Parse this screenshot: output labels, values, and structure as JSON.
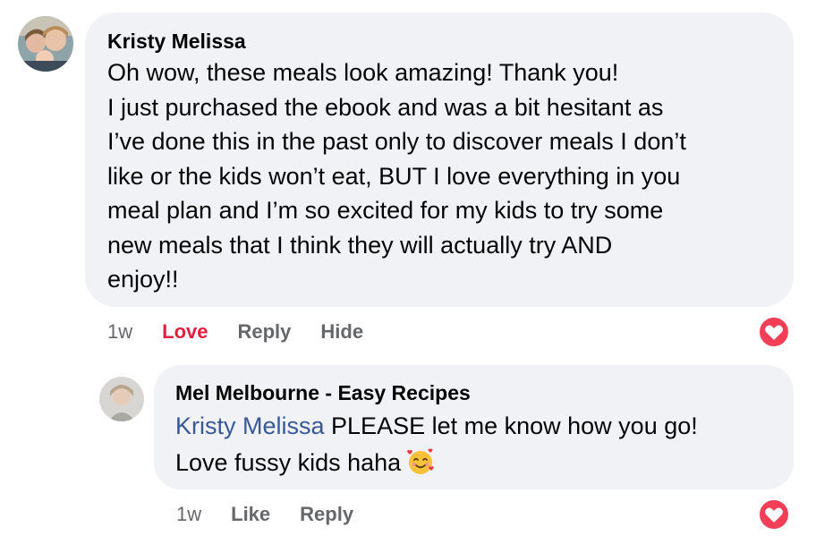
{
  "comment": {
    "author": "Kristy Melissa",
    "lines": [
      "Oh wow, these meals look amazing! Thank you!",
      "I just purchased the ebook and was a bit hesitant as",
      "I’ve done this in the past only to discover meals I don’t",
      "like or the kids won’t eat, BUT I love everything in you",
      "meal plan and I’m so excited for my kids to try some",
      "new meals that I think they will actually try AND",
      "enjoy!!"
    ],
    "time": "1w",
    "love_label": "Love",
    "reply_label": "Reply",
    "hide_label": "Hide",
    "reaction_icon": "love-reaction-icon",
    "reaction_color": "#f33e58"
  },
  "reply": {
    "author": "Mel Melbourne - Easy Recipes",
    "mention": "Kristy Melissa",
    "line1_rest": " PLEASE let me know how you go!",
    "line2": "Love fussy kids haha",
    "emoji_icon": "smiling-face-with-hearts-icon",
    "time": "1w",
    "like_label": "Like",
    "reply_label": "Reply",
    "reaction_icon": "love-reaction-icon",
    "reaction_color": "#f33e58"
  },
  "colors": {
    "bubble": "#f0f2f5",
    "secondary_text": "#65676b",
    "mention": "#385898",
    "love_text": "#e41e3f"
  }
}
